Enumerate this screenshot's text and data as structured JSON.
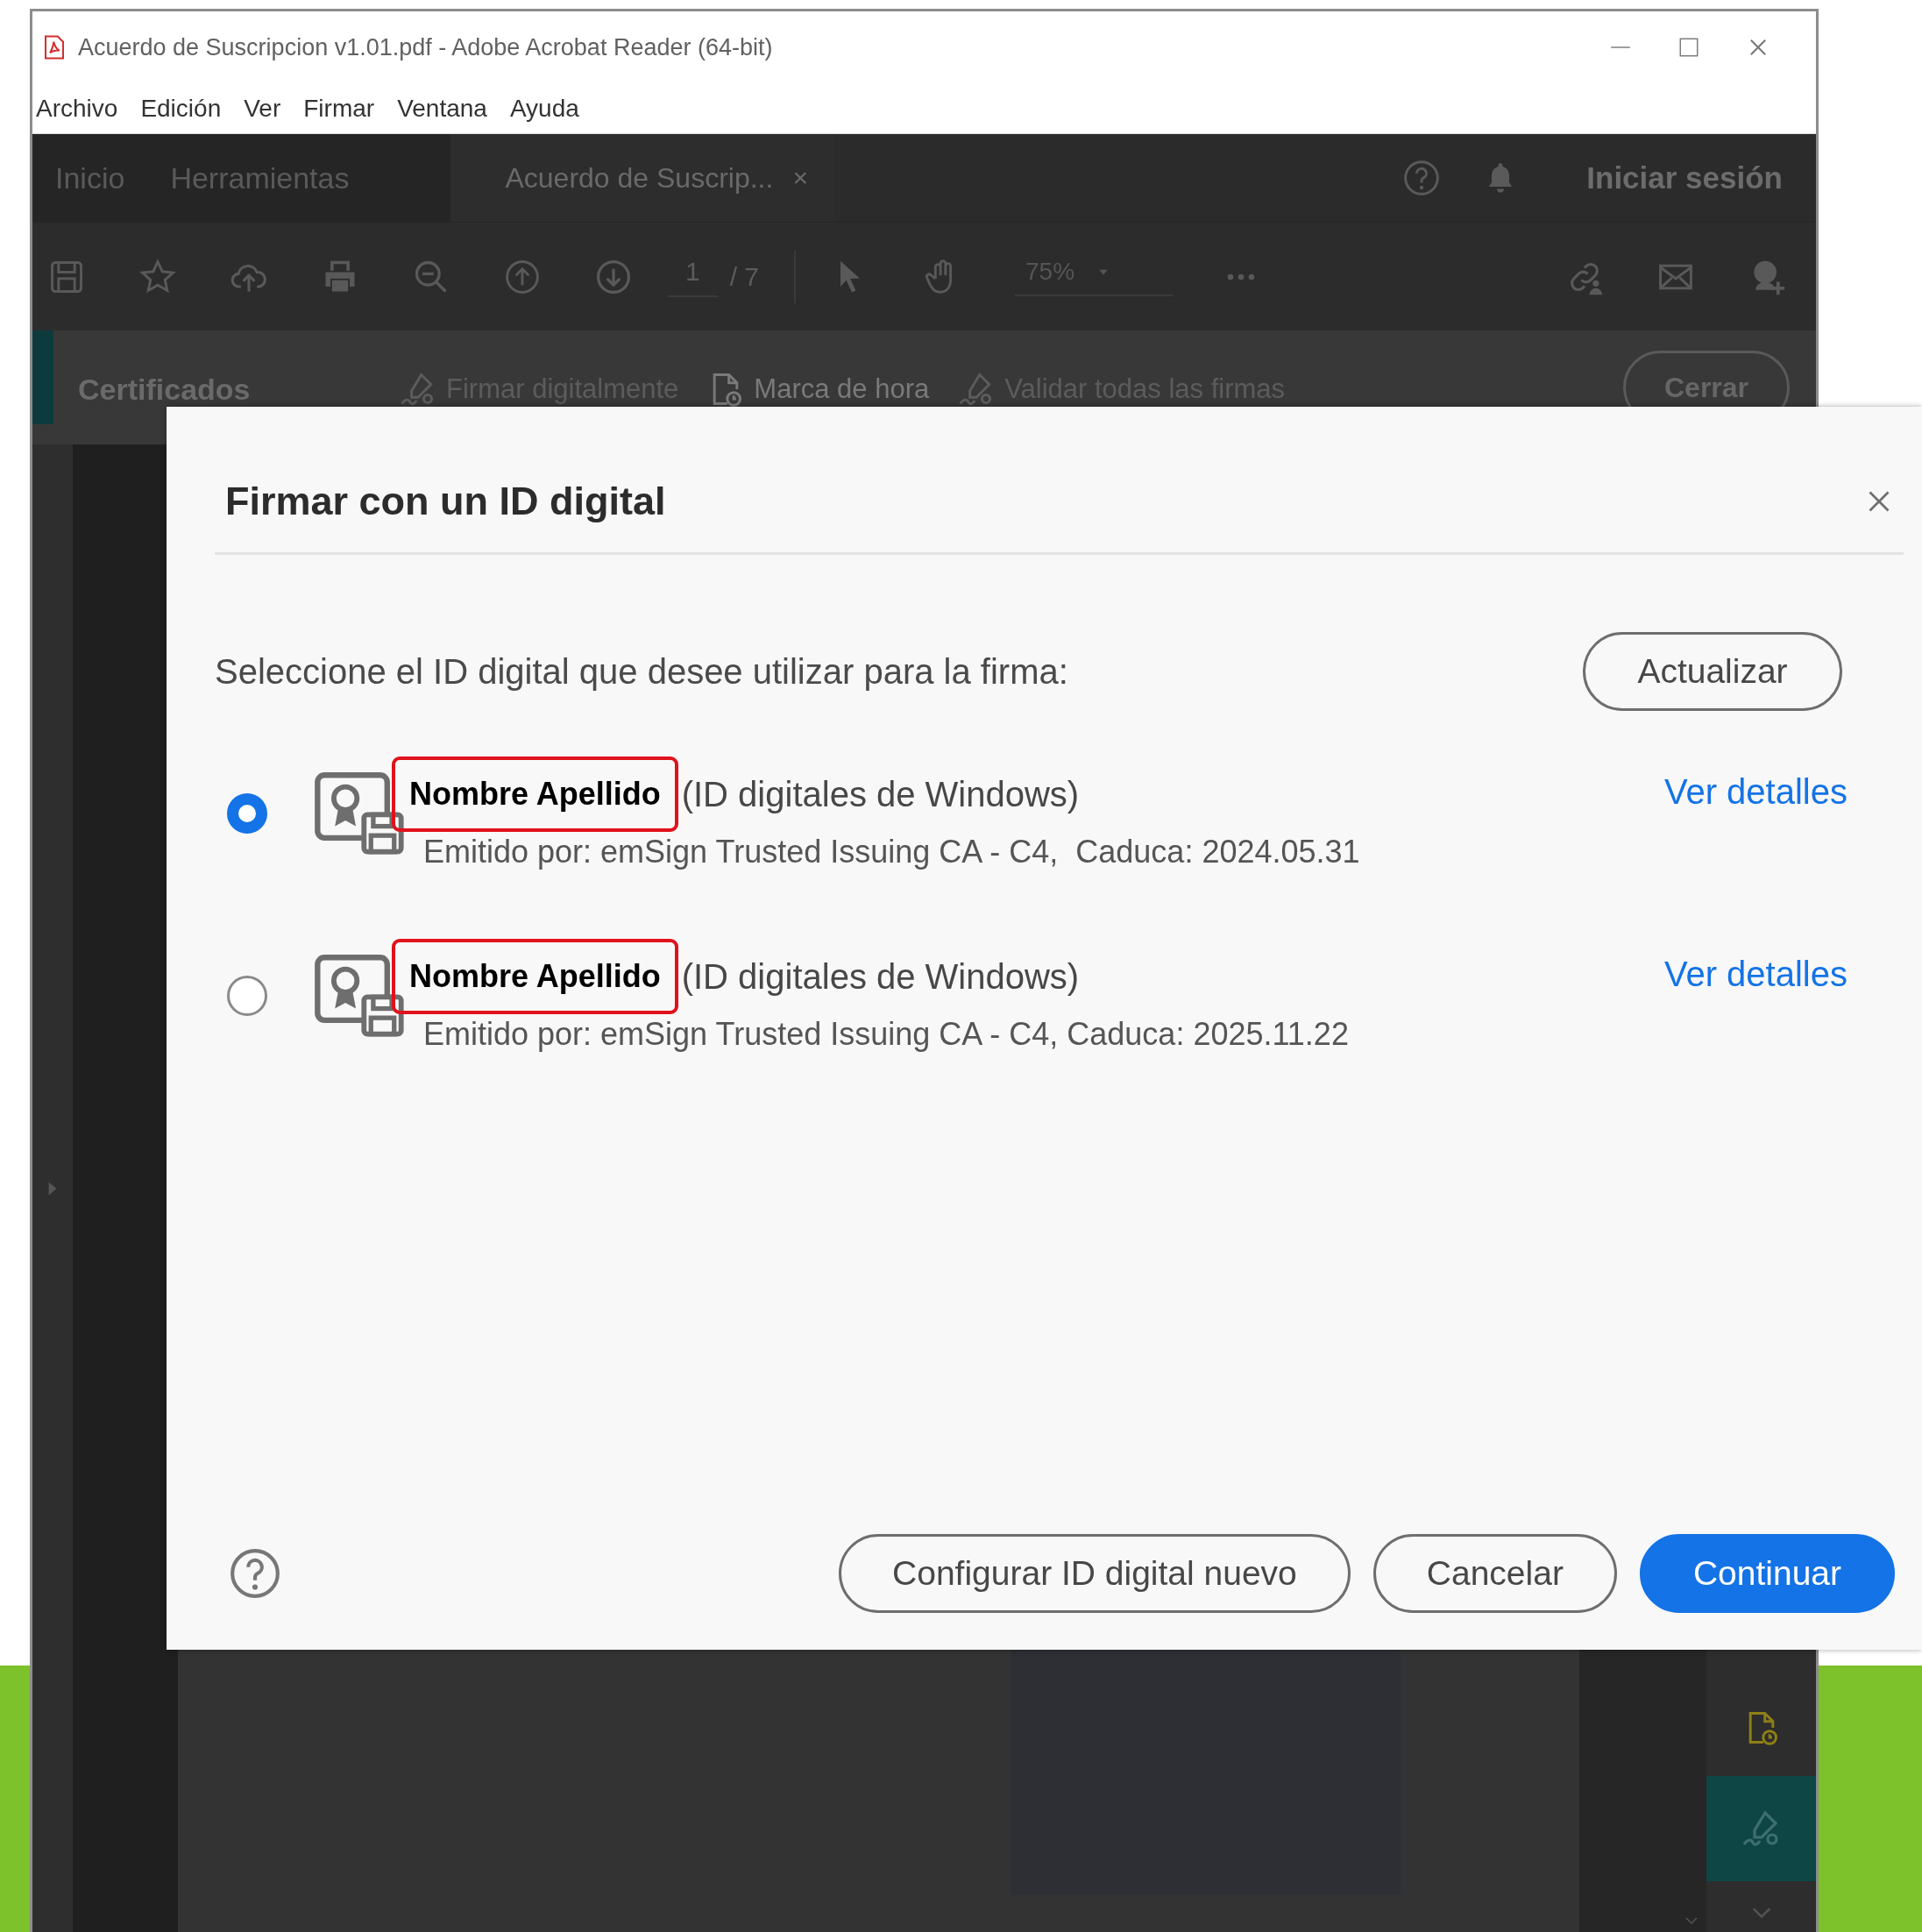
{
  "window": {
    "title": "Acuerdo de Suscripcion v1.01.pdf - Adobe Acrobat Reader (64-bit)"
  },
  "menu": [
    "Archivo",
    "Edición",
    "Ver",
    "Firmar",
    "Ventana",
    "Ayuda"
  ],
  "app_tabs": [
    {
      "label": "Inicio",
      "selected": false
    },
    {
      "label": "Herramientas",
      "selected": false
    },
    {
      "label": "Acuerdo de Suscrip...",
      "selected": true,
      "close": "×"
    }
  ],
  "sign_in": "Iniciar sesión",
  "toolbar": {
    "page": "1",
    "page_count": "/ 7",
    "zoom": "75%"
  },
  "cert_bar": {
    "title": "Certificados",
    "actions": [
      {
        "label": "Firmar digitalmente",
        "disabled": true
      },
      {
        "label": "Marca de hora",
        "disabled": false
      },
      {
        "label": "Validar todas las firmas",
        "disabled": true
      }
    ],
    "close": "Cerrar"
  },
  "dialog": {
    "title": "Firmar con un ID digital",
    "prompt": "Seleccione el ID digital que desee utilizar para la firma:",
    "refresh": "Actualizar",
    "ids": [
      {
        "name": "Nombre Apellido",
        "source": "(ID digitales de Windows)",
        "issuer": "Emitido por: emSign Trusted Issuing CA - C4,  Caduca: 2024.05.31",
        "link": "Ver detalles",
        "selected": true
      },
      {
        "name": "Nombre Apellido",
        "source": "(ID digitales de Windows)",
        "issuer": "Emitido por: emSign Trusted Issuing CA - C4, Caduca: 2025.11.22",
        "link": "Ver detalles",
        "selected": false
      }
    ],
    "buttons": [
      {
        "label": "Configurar ID digital nuevo",
        "kind": "secondary"
      },
      {
        "label": "Cancelar",
        "kind": "secondary"
      },
      {
        "label": "Continuar",
        "kind": "primary"
      }
    ]
  }
}
